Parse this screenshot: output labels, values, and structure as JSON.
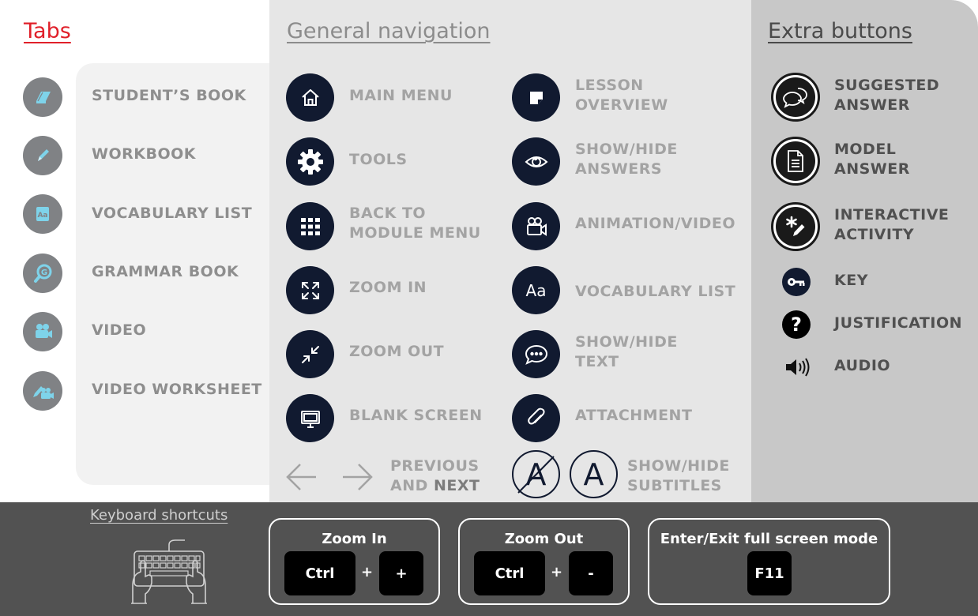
{
  "headings": {
    "tabs": "Tabs",
    "general": "General navigation",
    "extra": "Extra buttons"
  },
  "tabs": [
    {
      "label": "STUDENT’S BOOK",
      "icon": "students-book-icon"
    },
    {
      "label": "WORKBOOK",
      "icon": "workbook-icon"
    },
    {
      "label": "VOCABULARY LIST",
      "icon": "vocabulary-list-icon"
    },
    {
      "label": "GRAMMAR BOOK",
      "icon": "grammar-book-icon"
    },
    {
      "label": "VIDEO",
      "icon": "video-icon"
    },
    {
      "label": "VIDEO WORKSHEET",
      "icon": "video-worksheet-icon"
    }
  ],
  "general": {
    "left": [
      {
        "label": "MAIN MENU",
        "icon": "home-icon"
      },
      {
        "label": "TOOLS",
        "icon": "gear-icon"
      },
      {
        "label": "BACK TO\nMODULE MENU",
        "icon": "grid-icon"
      },
      {
        "label": "ZOOM IN",
        "icon": "zoom-in-icon"
      },
      {
        "label": "ZOOM OUT",
        "icon": "zoom-out-icon"
      },
      {
        "label": "BLANK SCREEN",
        "icon": "blank-screen-icon"
      }
    ],
    "right": [
      {
        "label": "LESSON\nOVERVIEW",
        "icon": "lesson-overview-icon"
      },
      {
        "label": "SHOW/HIDE\nANSWERS",
        "icon": "eye-icon"
      },
      {
        "label": "ANIMATION/VIDEO",
        "icon": "video-camera-icon"
      },
      {
        "label": "VOCABULARY LIST",
        "icon": "aa-icon",
        "icon_text": "Aa"
      },
      {
        "label": "SHOW/HIDE\nTEXT",
        "icon": "speech-bubble-icon"
      },
      {
        "label": "ATTACHMENT",
        "icon": "paperclip-icon"
      }
    ],
    "prev_next": {
      "line1": "PREVIOUS",
      "line2_a": "AND ",
      "line2_b": "NEXT"
    },
    "subtitles": {
      "label": "SHOW/HIDE\nSUBTITLES",
      "glyph": "A"
    }
  },
  "extra": [
    {
      "label": "SUGGESTED\nANSWER",
      "icon": "chat-bubbles-icon"
    },
    {
      "label": "MODEL\nANSWER",
      "icon": "document-icon"
    },
    {
      "label": "INTERACTIVE\nACTIVITY",
      "icon": "interactive-pencil-icon"
    },
    {
      "label": "KEY",
      "icon": "key-icon"
    },
    {
      "label": "JUSTIFICATION",
      "icon": "question-icon"
    },
    {
      "label": "AUDIO",
      "icon": "speaker-icon"
    }
  ],
  "shortcuts": {
    "title": "Keyboard shortcuts",
    "zoom_in": {
      "title": "Zoom In",
      "key1": "Ctrl",
      "plus": "+",
      "key2": "+"
    },
    "zoom_out": {
      "title": "Zoom Out",
      "key1": "Ctrl",
      "plus": "+",
      "key2": "-"
    },
    "fullscreen": {
      "title": "Enter/Exit full screen mode",
      "key1": "F11"
    }
  },
  "colors": {
    "accent_red": "#e0202a",
    "navy": "#111a30",
    "tab_icon_grey": "#808285",
    "tab_icon_blue": "#7ed3ea"
  }
}
